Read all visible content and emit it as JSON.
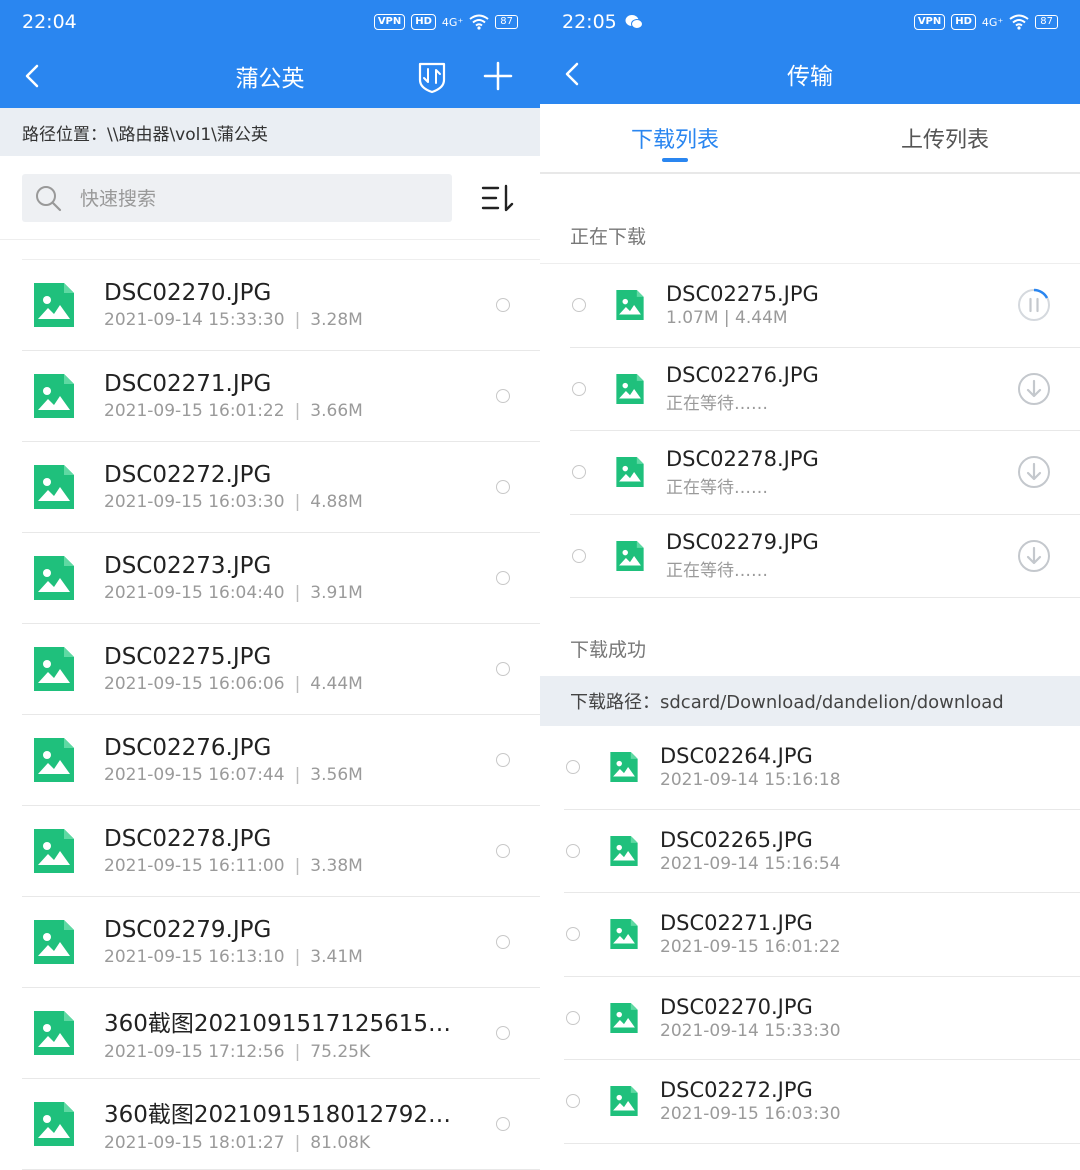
{
  "left": {
    "status": {
      "time": "22:04",
      "vpn": "VPN",
      "hd": "HD",
      "net": "4G⁺",
      "battery": "87"
    },
    "header": {
      "title": "蒲公英"
    },
    "path": "路径位置：\\\\路由器\\vol1\\蒲公英",
    "search_placeholder": "快速搜索",
    "files": [
      {
        "name": "DSC02270.JPG",
        "date": "2021-09-14 15:33:30",
        "size": "3.28M"
      },
      {
        "name": "DSC02271.JPG",
        "date": "2021-09-15 16:01:22",
        "size": "3.66M"
      },
      {
        "name": "DSC02272.JPG",
        "date": "2021-09-15 16:03:30",
        "size": "4.88M"
      },
      {
        "name": "DSC02273.JPG",
        "date": "2021-09-15 16:04:40",
        "size": "3.91M"
      },
      {
        "name": "DSC02275.JPG",
        "date": "2021-09-15 16:06:06",
        "size": "4.44M"
      },
      {
        "name": "DSC02276.JPG",
        "date": "2021-09-15 16:07:44",
        "size": "3.56M"
      },
      {
        "name": "DSC02278.JPG",
        "date": "2021-09-15 16:11:00",
        "size": "3.38M"
      },
      {
        "name": "DSC02279.JPG",
        "date": "2021-09-15 16:13:10",
        "size": "3.41M"
      },
      {
        "name": "360截图2021091517125615…",
        "date": "2021-09-15 17:12:56",
        "size": "75.25K"
      },
      {
        "name": "360截图2021091518012792…",
        "date": "2021-09-15 18:01:27",
        "size": "81.08K"
      }
    ]
  },
  "right": {
    "status": {
      "time": "22:05",
      "vpn": "VPN",
      "hd": "HD",
      "net": "4G⁺",
      "battery": "87"
    },
    "header": {
      "title": "传输"
    },
    "tabs": [
      {
        "label": "下载列表"
      },
      {
        "label": "上传列表"
      }
    ],
    "downloading_label": "正在下载",
    "downloading": [
      {
        "name": "DSC02275.JPG",
        "meta": "1.07M | 4.44M",
        "action": "pause-progress-icon"
      },
      {
        "name": "DSC02276.JPG",
        "meta": "正在等待……",
        "action": "download-icon"
      },
      {
        "name": "DSC02278.JPG",
        "meta": "正在等待……",
        "action": "download-icon"
      },
      {
        "name": "DSC02279.JPG",
        "meta": "正在等待……",
        "action": "download-icon"
      }
    ],
    "done_label": "下载成功",
    "download_path": "下载路径：sdcard/Download/dandelion/download",
    "done": [
      {
        "name": "DSC02264.JPG",
        "date": "2021-09-14 15:16:18"
      },
      {
        "name": "DSC02265.JPG",
        "date": "2021-09-14 15:16:54"
      },
      {
        "name": "DSC02271.JPG",
        "date": "2021-09-15 16:01:22"
      },
      {
        "name": "DSC02270.JPG",
        "date": "2021-09-14 15:33:30"
      },
      {
        "name": "DSC02272.JPG",
        "date": "2021-09-15 16:03:30"
      }
    ]
  },
  "colors": {
    "accent": "#2a86f0",
    "file_icon": "#1fc07c"
  }
}
